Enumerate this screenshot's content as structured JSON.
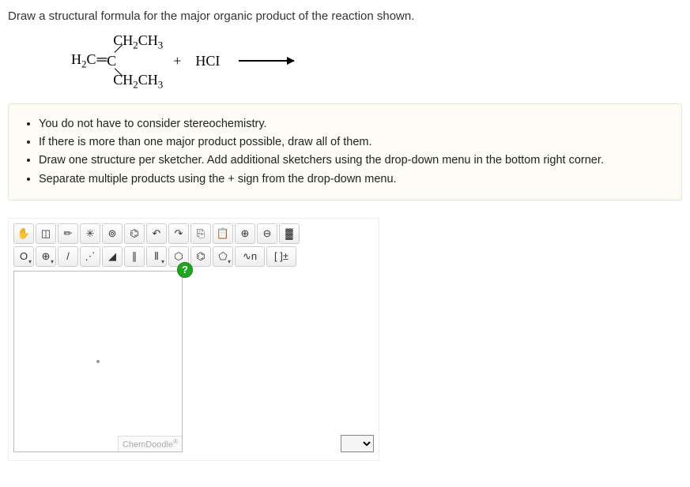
{
  "question": "Draw a structural formula for the major organic product of the reaction shown.",
  "reaction": {
    "left_fragment": "H₂C",
    "dbond": "=",
    "center_c": "C",
    "top_group": "CH₂CH₃",
    "bot_group": "CH₂CH₃",
    "plus": "+",
    "reagent": "HCl",
    "hcl_display": "HCI"
  },
  "hints": [
    "You do not have to consider stereochemistry.",
    "If there is more than one major product possible, draw all of them.",
    "Draw one structure per sketcher. Add additional sketchers using the drop-down menu in the bottom right corner.",
    "Separate multiple products using the + sign from the drop-down menu."
  ],
  "toolbar_row1": [
    {
      "name": "hand-icon",
      "glyph": "✋"
    },
    {
      "name": "lasso-icon",
      "glyph": "◫"
    },
    {
      "name": "eraser-icon",
      "glyph": "✏"
    },
    {
      "name": "clear-icon",
      "glyph": "✳"
    },
    {
      "name": "center-icon",
      "glyph": "⊚"
    },
    {
      "name": "clean-icon",
      "glyph": "⌬"
    },
    {
      "name": "undo-icon",
      "glyph": "↶"
    },
    {
      "name": "redo-icon",
      "glyph": "↷"
    },
    {
      "name": "copy-icon",
      "glyph": "⎘"
    },
    {
      "name": "paste-icon",
      "glyph": "📋"
    },
    {
      "name": "zoom-in-icon",
      "glyph": "⊕"
    },
    {
      "name": "zoom-out-icon",
      "glyph": "⊖"
    },
    {
      "name": "color-icon",
      "glyph": "▓"
    }
  ],
  "toolbar_row2": [
    {
      "name": "element-o",
      "label": "O",
      "dd": true
    },
    {
      "name": "charge-tool",
      "label": "⊕",
      "dd": true
    },
    {
      "name": "single-bond",
      "label": "/"
    },
    {
      "name": "recessed-bond",
      "label": "⋰"
    },
    {
      "name": "wedge-bond",
      "label": "◢"
    },
    {
      "name": "double-bond",
      "label": "∥"
    },
    {
      "name": "triple-bond",
      "label": "⦀",
      "dd": true
    },
    {
      "name": "cyclohexane-tool",
      "label": "⬡"
    },
    {
      "name": "benzene-tool",
      "label": "⌬"
    },
    {
      "name": "cyclopentane-tool",
      "label": "⬠",
      "dd": true
    },
    {
      "name": "chain-tool",
      "label": "∿n"
    },
    {
      "name": "bracket-tool",
      "label": "[ ]±"
    }
  ],
  "canvas": {
    "help_label": "?",
    "brand": "ChemDoodle",
    "brand_mark": "®"
  },
  "multi_select_options": [
    ""
  ]
}
